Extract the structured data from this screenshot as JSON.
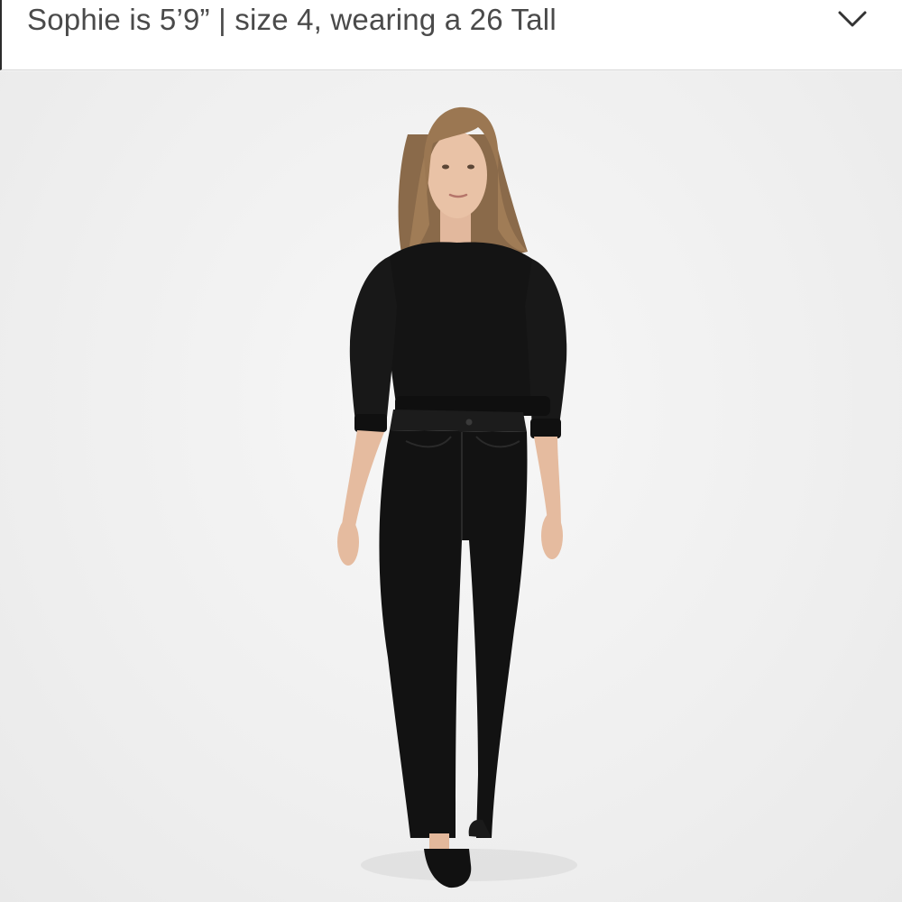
{
  "header": {
    "model_info": "Sophie is 5’9” | size 4, wearing a 26 Tall",
    "expand_icon": "chevron-down-icon"
  },
  "photo": {
    "subject": "model-wearing-black-sweatshirt-and-black-skinny-jeans"
  },
  "colors": {
    "header_text": "#4a4a4a",
    "background": "#f3f3f3",
    "garment": "#141414"
  }
}
